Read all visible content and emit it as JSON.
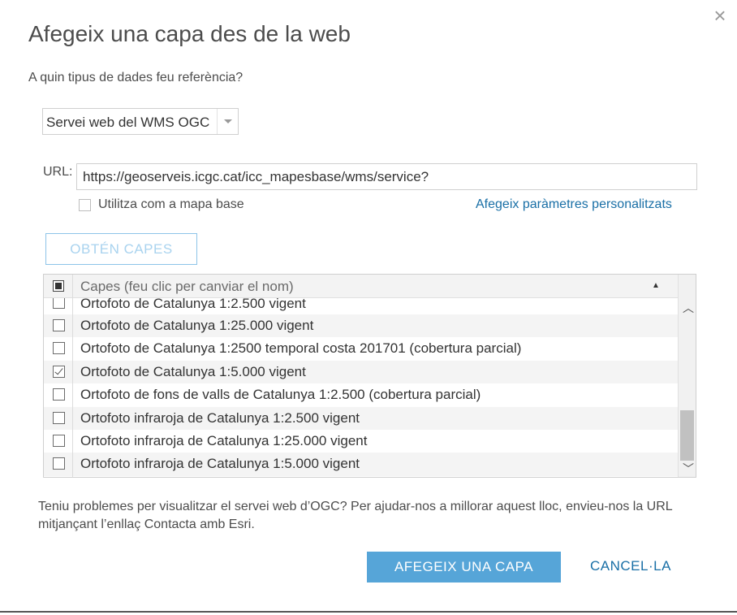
{
  "dialog": {
    "title": "Afegeix una capa des de la web",
    "close_icon": "close-icon",
    "question": "A quin tipus de dades feu referència?",
    "data_type_select": {
      "value": "Servei web del WMS OGC"
    },
    "url": {
      "label": "URL:",
      "value": "https://geoserveis.icgc.cat/icc_mapesbase/wms/service?"
    },
    "basemap": {
      "label": "Utilitza com a mapa base",
      "checked": false
    },
    "custom_params_link": "Afegeix paràmetres personalitzats",
    "get_layers_button": "OBTÉN CAPES",
    "layers_table": {
      "header": "Capes (feu clic per canviar el nom)",
      "rows": [
        {
          "name": "Ortofoto de Catalunya 1:2.500 vigent",
          "checked": false
        },
        {
          "name": "Ortofoto de Catalunya 1:25.000 vigent",
          "checked": false
        },
        {
          "name": "Ortofoto de Catalunya 1:2500 temporal costa 201701 (cobertura parcial)",
          "checked": false
        },
        {
          "name": "Ortofoto de Catalunya 1:5.000 vigent",
          "checked": true
        },
        {
          "name": "Ortofoto de fons de valls de Catalunya 1:2.500 (cobertura parcial)",
          "checked": false
        },
        {
          "name": "Ortofoto infraroja de Catalunya 1:2.500 vigent",
          "checked": false
        },
        {
          "name": "Ortofoto infraroja de Catalunya 1:25.000 vigent",
          "checked": false
        },
        {
          "name": "Ortofoto infraroja de Catalunya 1:5.000 vigent",
          "checked": false
        }
      ]
    },
    "help_text": "Teniu problemes per visualitzar el servei web d’OGC? Per ajudar-nos a millorar aquest lloc, envieu-nos la URL mitjançant l’enllaç Contacta amb Esri.",
    "add_layer_button": "AFEGEIX UNA CAPA",
    "cancel_button": "CANCEL·LA",
    "colors": {
      "primary_button": "#56a5d8",
      "link": "#196fa6"
    }
  }
}
